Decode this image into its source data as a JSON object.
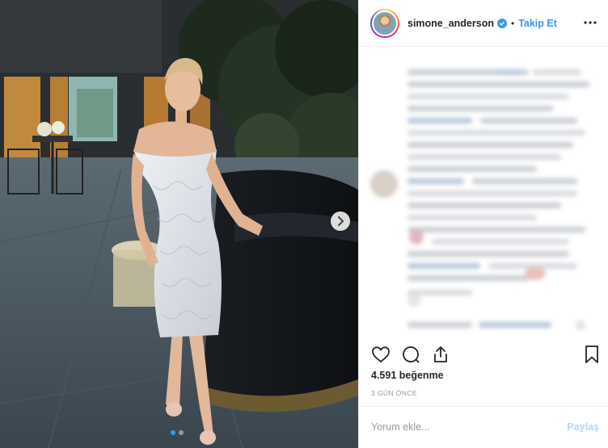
{
  "post": {
    "username": "simone_anderson",
    "verified": true,
    "separator": "•",
    "follow_label": "Takip Et",
    "more_icon": "more-horizontal-icon",
    "likes_text": "4.591 beğenme",
    "time_ago": "3 GÜN ÖNCE",
    "comment_placeholder": "Yorum ekle...",
    "share_label": "Paylaş"
  },
  "carousel": {
    "slide_count": 2,
    "active_index": 0
  },
  "colors": {
    "accent": "#3897f0",
    "text": "#262626",
    "muted": "#999999"
  }
}
